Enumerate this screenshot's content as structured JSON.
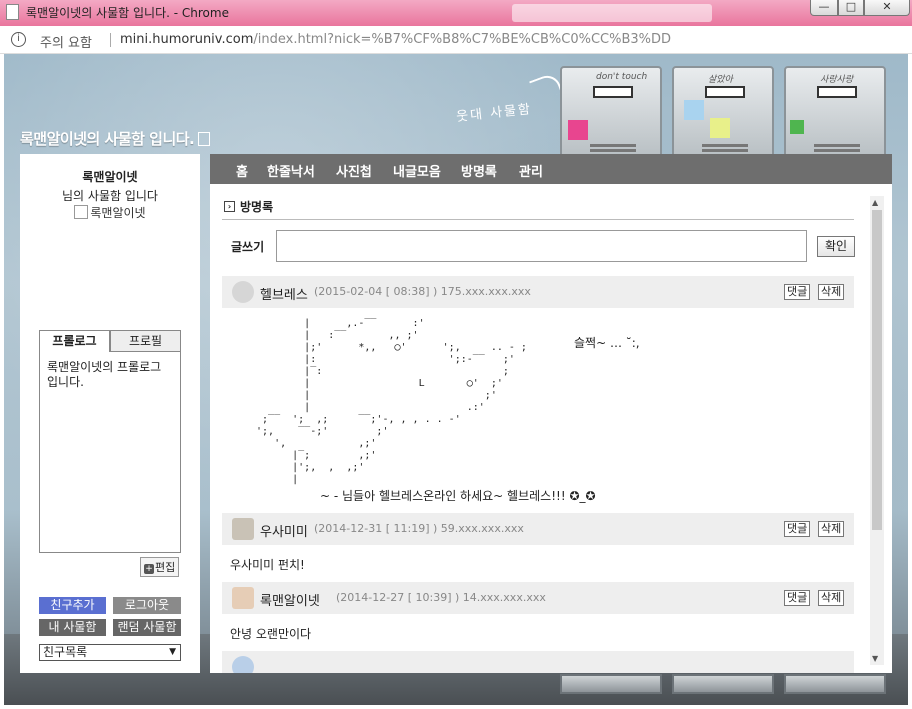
{
  "window": {
    "title": "록맨알이넷의 사물함 입니다. - Chrome",
    "btn_min": "—",
    "btn_max": "□",
    "btn_close": "✕"
  },
  "addressbar": {
    "info": "i",
    "warning": "주의 요함",
    "host": "mini.humoruniv.com",
    "path": "/index.html?nick=%B7%CF%B8%C7%BE%CB%C0%CC%B3%DD"
  },
  "header": {
    "site_title": "록맨알이넷의 사물함 입니다.",
    "tagline": "웃대 사물함"
  },
  "lockers": [
    {
      "scribble": "don't touch"
    },
    {
      "scribble": "살았아"
    },
    {
      "scribble": "사랑사랑"
    }
  ],
  "left": {
    "owner": "록맨알이넷",
    "subtitle": "님의 사물함 입니다",
    "avatar_alt": "록맨알이넷",
    "tab_prologue": "프롤로그",
    "tab_profile": "프로필",
    "prologue_text": "록맨알이넷의 프롤로그 입니다.",
    "edit": "편집",
    "btn_add_friend": "친구추가",
    "btn_logout": "로그아웃",
    "btn_my_locker": "내 사물함",
    "btn_random_locker": "랜덤 사물함",
    "friend_list": "친구목록"
  },
  "nav": {
    "items": [
      "홈",
      "한줄낙서",
      "사진첩",
      "내글모음",
      "방명록",
      "관리"
    ]
  },
  "guestbook": {
    "section_title": "방명록",
    "write_label": "글쓰기",
    "confirm": "확인",
    "reply": "댓글",
    "delete": "삭제",
    "entries": [
      {
        "name": "헬브레스",
        "meta": "(2015-02-04 [ 08:38] ) 175.xxx.xxx.xxx",
        "body_right": "슬쩍~            …     ˘:,",
        "body_last": "~ - 님들아 헬브레스온라인 하세요~ 헬브레스!!! ✪_✪"
      },
      {
        "name": "우사미미",
        "meta": "(2014-12-31 [ 11:19] ) 59.xxx.xxx.xxx",
        "body": "우사미미 펀치!"
      },
      {
        "name": "록맨알이넷",
        "meta": "(2014-12-27 [ 10:39] ) 14.xxx.xxx.xxx",
        "body": "안녕 오랜만이다"
      }
    ]
  },
  "colors": {
    "titlebar": "#e9759d",
    "nav": "#6e6e6e",
    "btn_blue": "#5a6fd1"
  }
}
